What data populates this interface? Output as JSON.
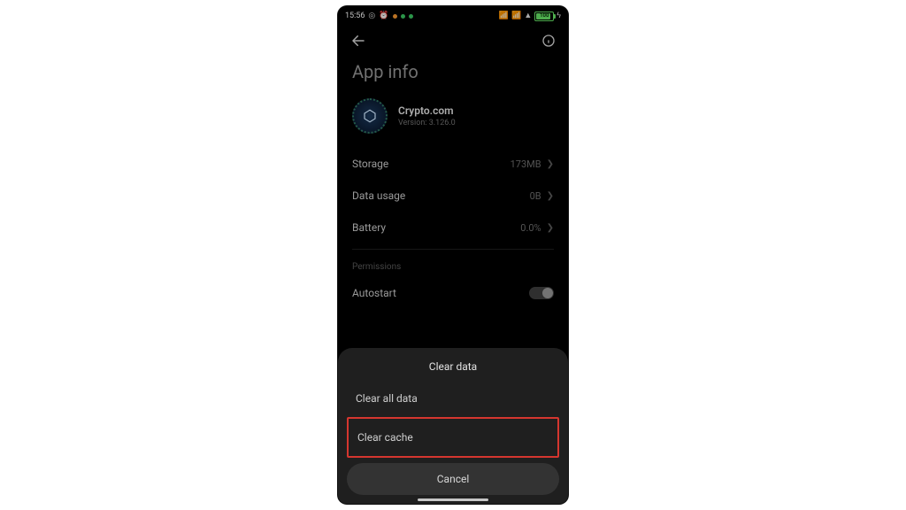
{
  "statusbar": {
    "time": "15:56",
    "battery_label": "100"
  },
  "header": {
    "title": "App info"
  },
  "app": {
    "name": "Crypto.com",
    "version_label": "Version: 3.126.0"
  },
  "rows": {
    "storage": {
      "label": "Storage",
      "value": "173MB"
    },
    "data_usage": {
      "label": "Data usage",
      "value": "0B"
    },
    "battery": {
      "label": "Battery",
      "value": "0.0%"
    }
  },
  "permissions_section": {
    "label": "Permissions"
  },
  "autostart": {
    "label": "Autostart",
    "enabled": false
  },
  "sheet": {
    "title": "Clear data",
    "clear_all": "Clear all data",
    "clear_cache": "Clear cache",
    "cancel": "Cancel"
  }
}
